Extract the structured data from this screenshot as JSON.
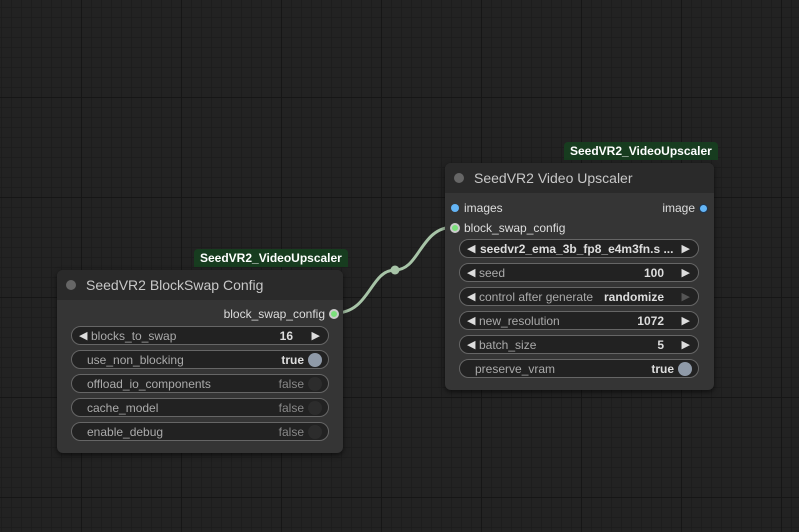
{
  "nodes": {
    "upscaler": {
      "badge": "SeedVR2_VideoUpscaler",
      "title": "SeedVR2 Video Upscaler",
      "inputs": [
        "images",
        "block_swap_config"
      ],
      "output": "image",
      "widgets": [
        {
          "label": "",
          "value": "seedvr2_ema_3b_fp8_e4m3fn.s ..."
        },
        {
          "label": "seed",
          "value": "100"
        },
        {
          "label": "control after generate",
          "value": "randomize"
        },
        {
          "label": "new_resolution",
          "value": "1072"
        },
        {
          "label": "batch_size",
          "value": "5"
        },
        {
          "label": "preserve_vram",
          "value": "true"
        }
      ]
    },
    "blockswap": {
      "badge": "SeedVR2_VideoUpscaler",
      "title": "SeedVR2 BlockSwap Config",
      "output": "block_swap_config",
      "widgets": [
        {
          "label": "blocks_to_swap",
          "value": "16"
        },
        {
          "label": "use_non_blocking",
          "value": "true"
        },
        {
          "label": "offload_io_components",
          "value": "false"
        },
        {
          "label": "cache_model",
          "value": "false"
        },
        {
          "label": "enable_debug",
          "value": "false"
        }
      ]
    }
  },
  "icons": {
    "arrow_left": "◀",
    "arrow_right": "▶"
  },
  "colors": {
    "badge_bg": "#173c1f",
    "link": "#a7c4a7",
    "image_slot": "#64b5f6",
    "config_slot": "#7be07b"
  }
}
